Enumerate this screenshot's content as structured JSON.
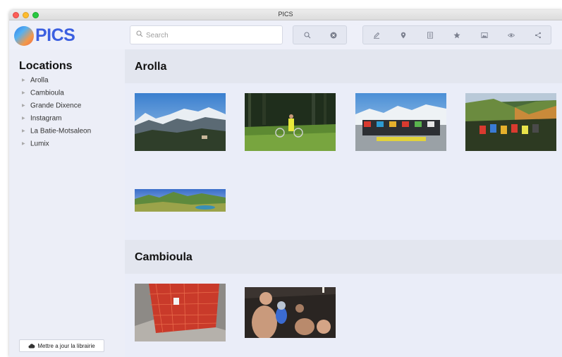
{
  "window": {
    "title": "PICS"
  },
  "logo": {
    "text": "PICS"
  },
  "search": {
    "placeholder": "Search",
    "value": ""
  },
  "toolbar_icons": {
    "search_group": [
      "search-icon",
      "clear-icon"
    ],
    "actions": [
      "edit-icon",
      "location-pin-icon",
      "list-icon",
      "star-icon",
      "image-icon",
      "eye-icon",
      "share-icon"
    ]
  },
  "sidebar": {
    "title": "Locations",
    "items": [
      {
        "label": "Arolla"
      },
      {
        "label": "Cambioula"
      },
      {
        "label": "Grande Dixence"
      },
      {
        "label": "Instagram"
      },
      {
        "label": "La Batie-Motsaleon"
      },
      {
        "label": "Lumix"
      }
    ],
    "update_button": "Mettre a jour la librairie"
  },
  "sections": [
    {
      "title": "Arolla",
      "photos": [
        {
          "subject": "mountain-panorama"
        },
        {
          "subject": "forest-cyclist"
        },
        {
          "subject": "group-bikes-snow"
        },
        {
          "subject": "group-bikes-valley"
        },
        {
          "subject": "alpine-lake"
        }
      ]
    },
    {
      "title": "Cambioula",
      "photos": [
        {
          "subject": "orange-net-rocks"
        },
        {
          "subject": "cave-group"
        }
      ]
    }
  ]
}
